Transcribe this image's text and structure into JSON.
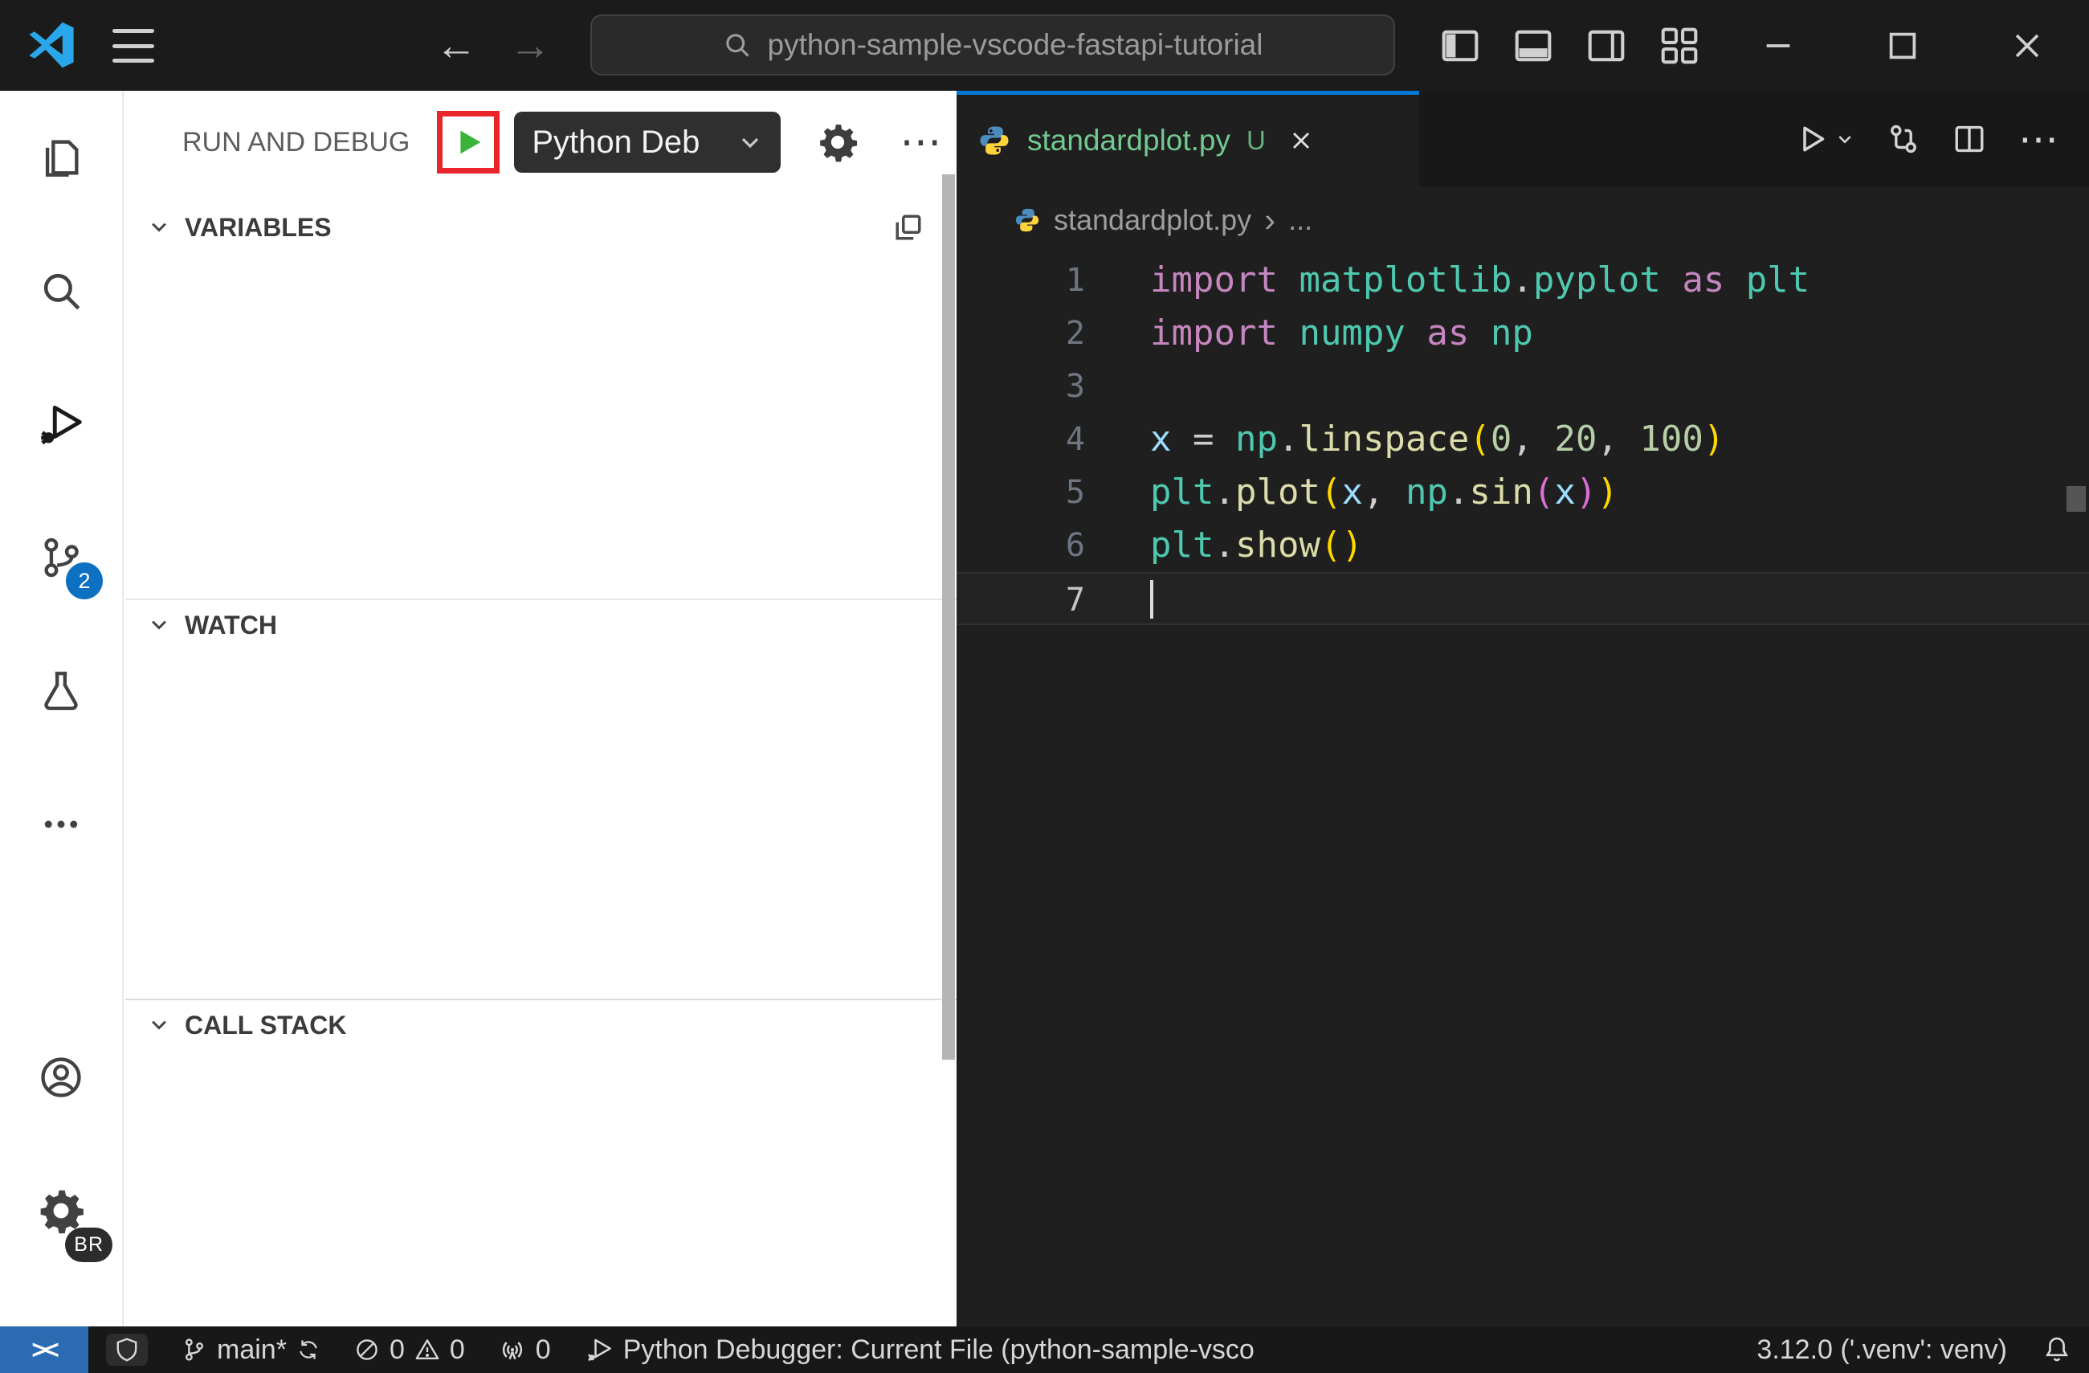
{
  "title_bar": {
    "search_text": "python-sample-vscode-fastapi-tutorial"
  },
  "icons": {
    "back_arrow": "←",
    "forward_arrow": "→",
    "more_horizontal": "⋯",
    "breadcrumb_separator": "›",
    "remote_glyph": "><"
  },
  "activity_bar": {
    "source_control_badge": "2",
    "profile_badge": "BR"
  },
  "sidebar": {
    "title": "RUN AND DEBUG",
    "debug_dropdown_value": "Python Deb",
    "sections": [
      {
        "label": "VARIABLES"
      },
      {
        "label": "WATCH"
      },
      {
        "label": "CALL STACK"
      }
    ]
  },
  "editor": {
    "tab": {
      "label": "standardplot.py",
      "git_status": "U"
    },
    "breadcrumb": {
      "file": "standardplot.py",
      "more": "..."
    },
    "code_lines": [
      {
        "num": "1",
        "tokens": [
          [
            "kw",
            "import"
          ],
          [
            "pln",
            " "
          ],
          [
            "mod",
            "matplotlib"
          ],
          [
            "pln",
            "."
          ],
          [
            "mod",
            "pyplot"
          ],
          [
            "pln",
            " "
          ],
          [
            "kw",
            "as"
          ],
          [
            "pln",
            " "
          ],
          [
            "mod",
            "plt"
          ]
        ]
      },
      {
        "num": "2",
        "tokens": [
          [
            "kw",
            "import"
          ],
          [
            "pln",
            " "
          ],
          [
            "mod",
            "numpy"
          ],
          [
            "pln",
            " "
          ],
          [
            "kw",
            "as"
          ],
          [
            "pln",
            " "
          ],
          [
            "mod",
            "np"
          ]
        ]
      },
      {
        "num": "3",
        "tokens": []
      },
      {
        "num": "4",
        "tokens": [
          [
            "vr",
            "x"
          ],
          [
            "pln",
            " = "
          ],
          [
            "mod",
            "np"
          ],
          [
            "pln",
            "."
          ],
          [
            "fn",
            "linspace"
          ],
          [
            "b1",
            "("
          ],
          [
            "num",
            "0"
          ],
          [
            "pln",
            ", "
          ],
          [
            "num",
            "20"
          ],
          [
            "pln",
            ", "
          ],
          [
            "num",
            "100"
          ],
          [
            "b1",
            ")"
          ]
        ]
      },
      {
        "num": "5",
        "tokens": [
          [
            "mod",
            "plt"
          ],
          [
            "pln",
            "."
          ],
          [
            "fn",
            "plot"
          ],
          [
            "b1",
            "("
          ],
          [
            "vr",
            "x"
          ],
          [
            "pln",
            ", "
          ],
          [
            "mod",
            "np"
          ],
          [
            "pln",
            "."
          ],
          [
            "fn",
            "sin"
          ],
          [
            "b2",
            "("
          ],
          [
            "vr",
            "x"
          ],
          [
            "b2",
            ")"
          ],
          [
            "b1",
            ")"
          ]
        ]
      },
      {
        "num": "6",
        "tokens": [
          [
            "mod",
            "plt"
          ],
          [
            "pln",
            "."
          ],
          [
            "fn",
            "show"
          ],
          [
            "b1",
            "("
          ],
          [
            "b1",
            ")"
          ]
        ]
      },
      {
        "num": "7",
        "tokens": [],
        "current": true,
        "cursor": true
      }
    ]
  },
  "status_bar": {
    "branch": "main*",
    "errors": "0",
    "warnings": "0",
    "ports": "0",
    "debugger": "Python Debugger: Current File (python-sample-vsco",
    "python_version": "3.12.0 ('.venv': venv)"
  },
  "colors": {
    "accent_blue": "#0078d4",
    "untracked_green": "#73c991",
    "annotation_red": "#e8252a",
    "play_green": "#3bb33b",
    "remote_blue": "#2b6bb2"
  }
}
